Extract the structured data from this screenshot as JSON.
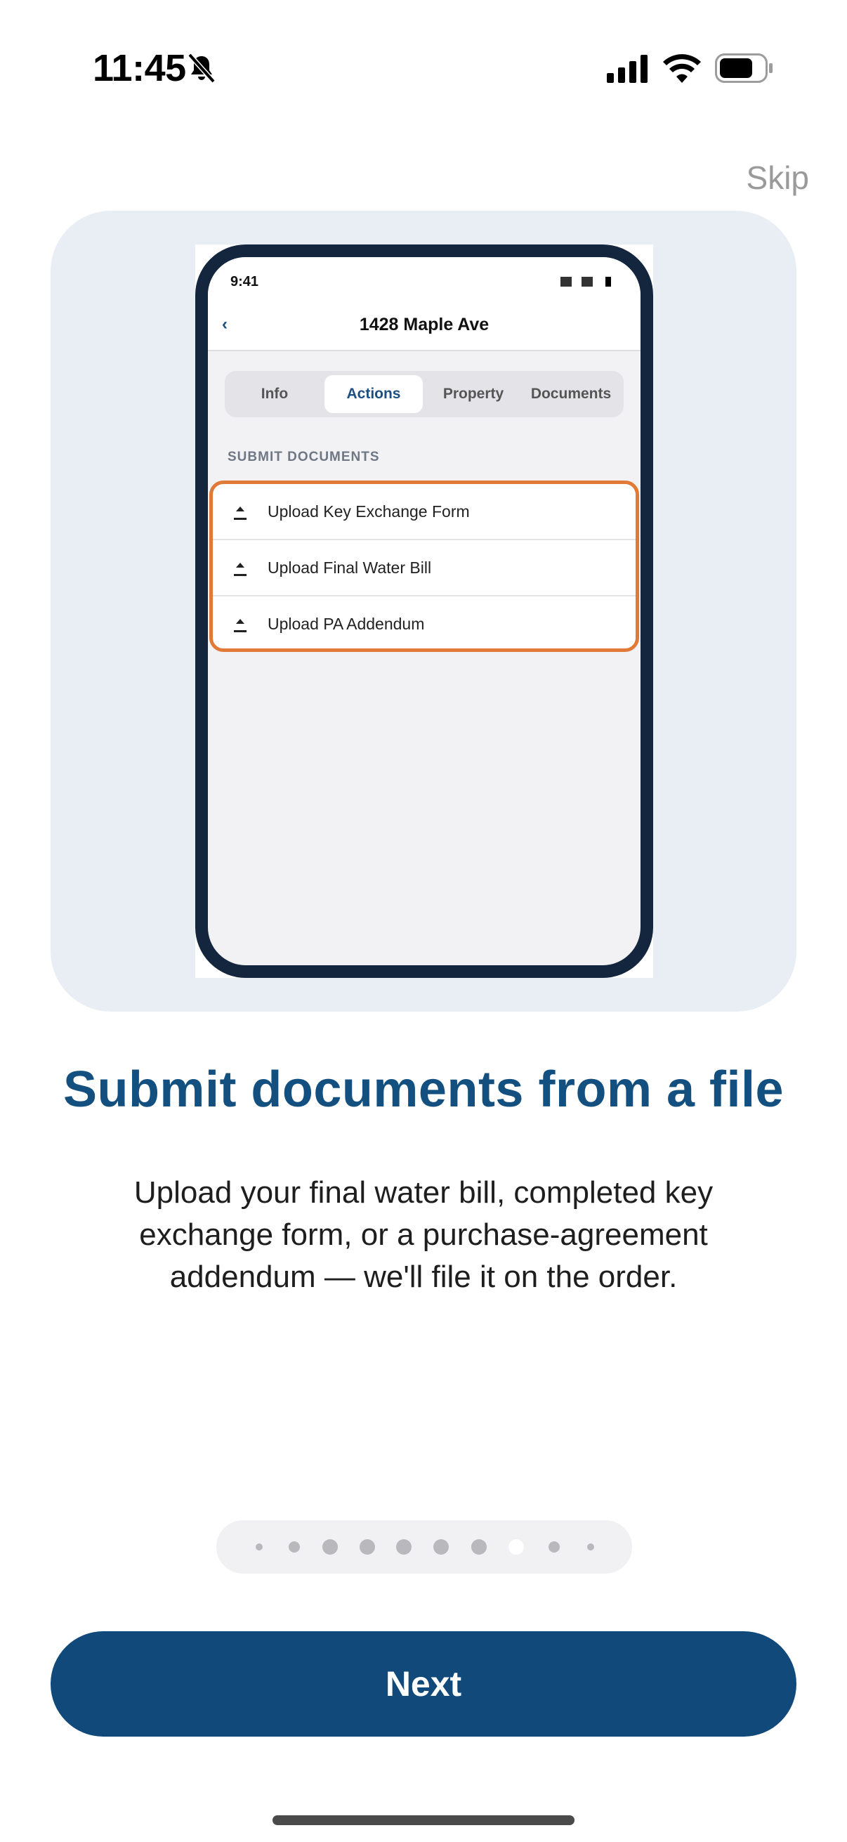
{
  "status_bar": {
    "time": "11:45"
  },
  "skip_label": "Skip",
  "preview": {
    "status_time": "9:41",
    "nav_back": "‹",
    "nav_title": "1428 Maple Ave",
    "tabs": [
      {
        "label": "Info",
        "active": false
      },
      {
        "label": "Actions",
        "active": true
      },
      {
        "label": "Property",
        "active": false
      },
      {
        "label": "Documents",
        "active": false
      }
    ],
    "section_header": "SUBMIT DOCUMENTS",
    "list_items": [
      {
        "label": "Upload Key Exchange Form"
      },
      {
        "label": "Upload Final Water Bill"
      },
      {
        "label": "Upload PA Addendum"
      }
    ],
    "highlight_color": "#e07a36"
  },
  "headline": "Submit documents from a file",
  "body": "Upload your final water bill, completed key exchange form, or a purchase-agreement addendum — we'll file it on the order.",
  "pager": {
    "total": 10,
    "active_index": 7
  },
  "next_label": "Next",
  "colors": {
    "brand": "#10497a",
    "headline": "#14507f",
    "card": "#e9eef5"
  }
}
